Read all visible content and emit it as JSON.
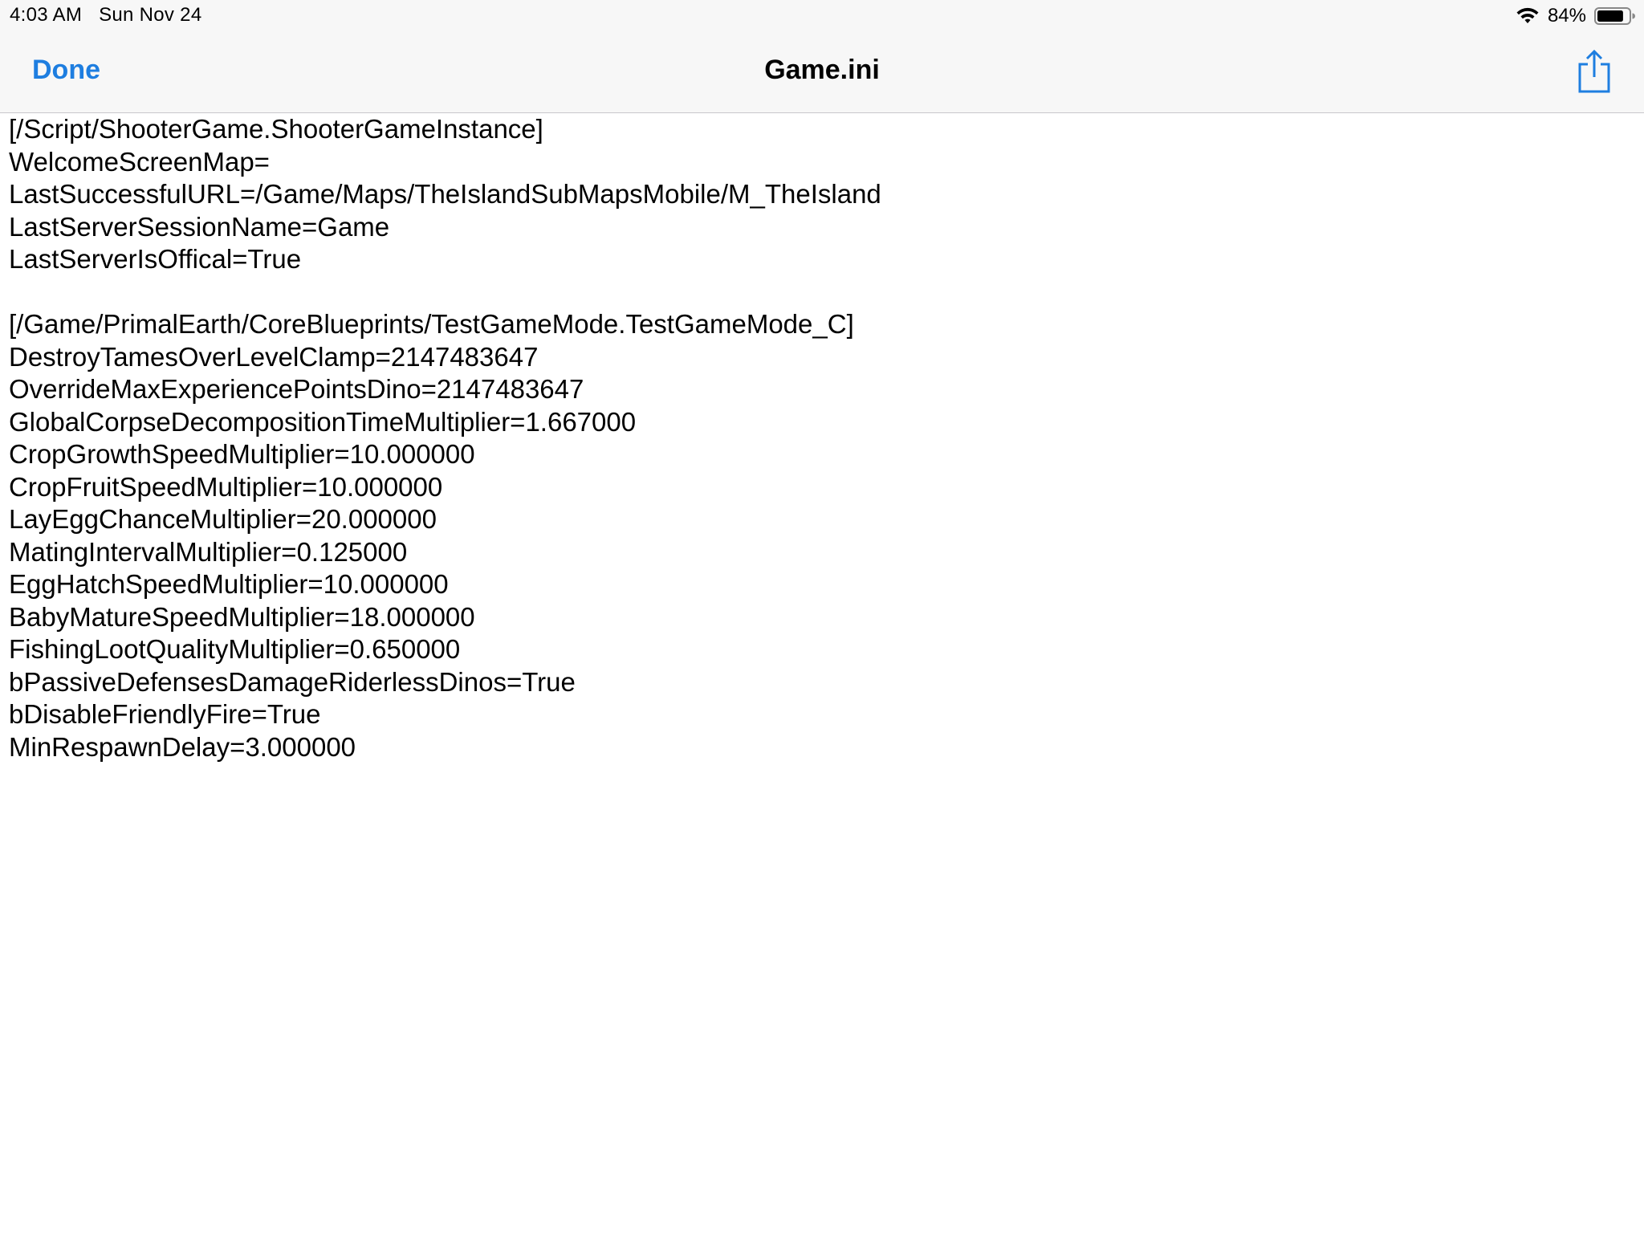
{
  "status_bar": {
    "time": "4:03 AM",
    "date": "Sun Nov 24",
    "battery_percent": "84%",
    "battery_level": 0.84,
    "icons": [
      "wifi-icon",
      "battery-icon"
    ]
  },
  "nav_bar": {
    "done_label": "Done",
    "title": "Game.ini",
    "share_icon": "share-icon"
  },
  "colors": {
    "accent": "#1E7EE0",
    "bar_background": "#F7F7F7",
    "text": "#000000"
  },
  "document": {
    "lines": [
      "[/Script/ShooterGame.ShooterGameInstance]",
      "WelcomeScreenMap=",
      "LastSuccessfulURL=/Game/Maps/TheIslandSubMapsMobile/M_TheIsland",
      "LastServerSessionName=Game",
      "LastServerIsOffical=True",
      "",
      "[/Game/PrimalEarth/CoreBlueprints/TestGameMode.TestGameMode_C]",
      "DestroyTamesOverLevelClamp=2147483647",
      "OverrideMaxExperiencePointsDino=2147483647",
      "GlobalCorpseDecompositionTimeMultiplier=1.667000",
      "CropGrowthSpeedMultiplier=10.000000",
      "CropFruitSpeedMultiplier=10.000000",
      "LayEggChanceMultiplier=20.000000",
      "MatingIntervalMultiplier=0.125000",
      "EggHatchSpeedMultiplier=10.000000",
      "BabyMatureSpeedMultiplier=18.000000",
      "FishingLootQualityMultiplier=0.650000",
      "bPassiveDefensesDamageRiderlessDinos=True",
      "bDisableFriendlyFire=True",
      "MinRespawnDelay=3.000000"
    ]
  }
}
